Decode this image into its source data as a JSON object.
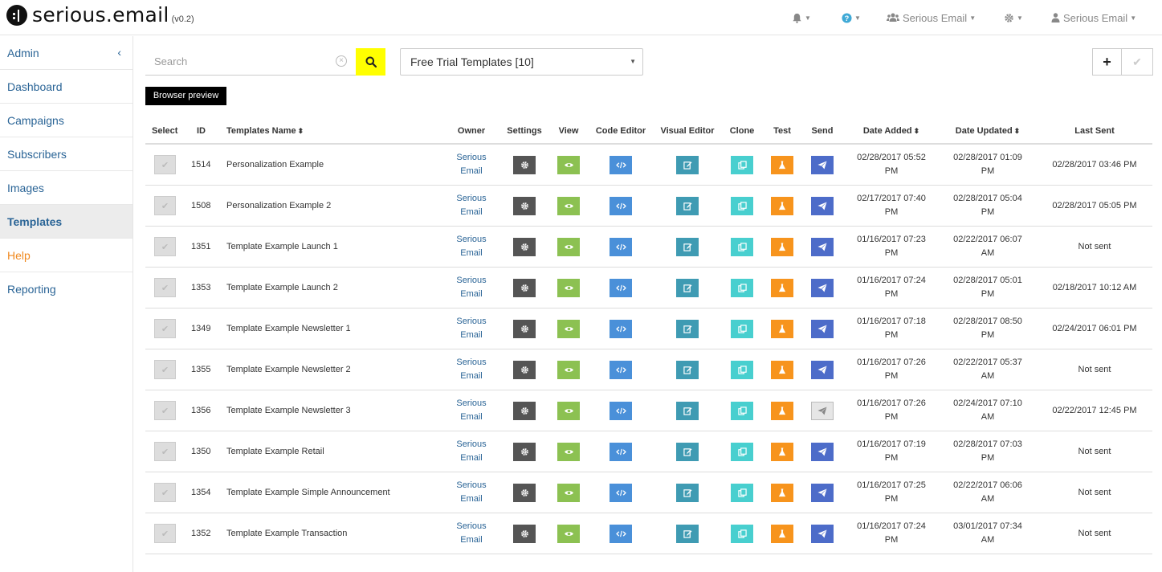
{
  "app": {
    "name": "serious.email",
    "version": "(v0.2)"
  },
  "topnav": {
    "account_label": "Serious Email",
    "user_label": "Serious Email",
    "icons": [
      "bell-icon",
      "help-icon",
      "users-icon",
      "gear-icon",
      "user-icon"
    ]
  },
  "sidebar": {
    "items": [
      {
        "label": "Admin"
      },
      {
        "label": "Dashboard"
      },
      {
        "label": "Campaigns"
      },
      {
        "label": "Subscribers"
      },
      {
        "label": "Images"
      },
      {
        "label": "Templates"
      },
      {
        "label": "Help"
      },
      {
        "label": "Reporting"
      }
    ],
    "active": "Templates"
  },
  "toolbar": {
    "search_placeholder": "Search",
    "folder_select": "Free Trial Templates [10]",
    "add_label": "+",
    "confirm_label": "✔",
    "browser_preview": "Browser preview"
  },
  "colors": {
    "search_button": "#ffff00",
    "settings": "#555555",
    "view": "#8cc152",
    "code_editor": "#4a90d9",
    "visual_editor": "#3f9bb3",
    "clone": "#48cfcf",
    "test": "#f7941d",
    "send": "#4d6cc9",
    "link": "#2a6496"
  },
  "table": {
    "headers": {
      "select": "Select",
      "id": "ID",
      "name": "Templates Name",
      "owner": "Owner",
      "settings": "Settings",
      "view": "View",
      "code_editor": "Code Editor",
      "visual_editor": "Visual Editor",
      "clone": "Clone",
      "test": "Test",
      "send": "Send",
      "date_added": "Date Added",
      "date_updated": "Date Updated",
      "last_sent": "Last Sent"
    },
    "rows": [
      {
        "id": "1514",
        "name": "Personalization Example",
        "owner1": "Serious",
        "owner2": "Email",
        "added1": "02/28/2017 05:52",
        "added2": "PM",
        "updated1": "02/28/2017 01:09",
        "updated2": "PM",
        "last_sent": "02/28/2017 03:46 PM"
      },
      {
        "id": "1508",
        "name": "Personalization Example 2",
        "owner1": "Serious",
        "owner2": "Email",
        "added1": "02/17/2017 07:40",
        "added2": "PM",
        "updated1": "02/28/2017 05:04",
        "updated2": "PM",
        "last_sent": "02/28/2017 05:05 PM"
      },
      {
        "id": "1351",
        "name": "Template Example Launch 1",
        "owner1": "Serious",
        "owner2": "Email",
        "added1": "01/16/2017 07:23",
        "added2": "PM",
        "updated1": "02/22/2017 06:07",
        "updated2": "AM",
        "last_sent": "Not sent"
      },
      {
        "id": "1353",
        "name": "Template Example Launch 2",
        "owner1": "Serious",
        "owner2": "Email",
        "added1": "01/16/2017 07:24",
        "added2": "PM",
        "updated1": "02/28/2017 05:01",
        "updated2": "PM",
        "last_sent": "02/18/2017 10:12 AM"
      },
      {
        "id": "1349",
        "name": "Template Example Newsletter 1",
        "owner1": "Serious",
        "owner2": "Email",
        "added1": "01/16/2017 07:18",
        "added2": "PM",
        "updated1": "02/28/2017 08:50",
        "updated2": "PM",
        "last_sent": "02/24/2017 06:01 PM"
      },
      {
        "id": "1355",
        "name": "Template Example Newsletter 2",
        "owner1": "Serious",
        "owner2": "Email",
        "added1": "01/16/2017 07:26",
        "added2": "PM",
        "updated1": "02/22/2017 05:37",
        "updated2": "AM",
        "last_sent": "Not sent"
      },
      {
        "id": "1356",
        "name": "Template Example Newsletter 3",
        "owner1": "Serious",
        "owner2": "Email",
        "added1": "01/16/2017 07:26",
        "added2": "PM",
        "updated1": "02/24/2017 07:10",
        "updated2": "AM",
        "last_sent": "02/22/2017 12:45 PM",
        "send_hover": true
      },
      {
        "id": "1350",
        "name": "Template Example Retail",
        "owner1": "Serious",
        "owner2": "Email",
        "added1": "01/16/2017 07:19",
        "added2": "PM",
        "updated1": "02/28/2017 07:03",
        "updated2": "PM",
        "last_sent": "Not sent"
      },
      {
        "id": "1354",
        "name": "Template Example Simple Announcement",
        "owner1": "Serious",
        "owner2": "Email",
        "added1": "01/16/2017 07:25",
        "added2": "PM",
        "updated1": "02/22/2017 06:06",
        "updated2": "AM",
        "last_sent": "Not sent"
      },
      {
        "id": "1352",
        "name": "Template Example Transaction",
        "owner1": "Serious",
        "owner2": "Email",
        "added1": "01/16/2017 07:24",
        "added2": "PM",
        "updated1": "03/01/2017 07:34",
        "updated2": "AM",
        "last_sent": "Not sent"
      }
    ]
  }
}
